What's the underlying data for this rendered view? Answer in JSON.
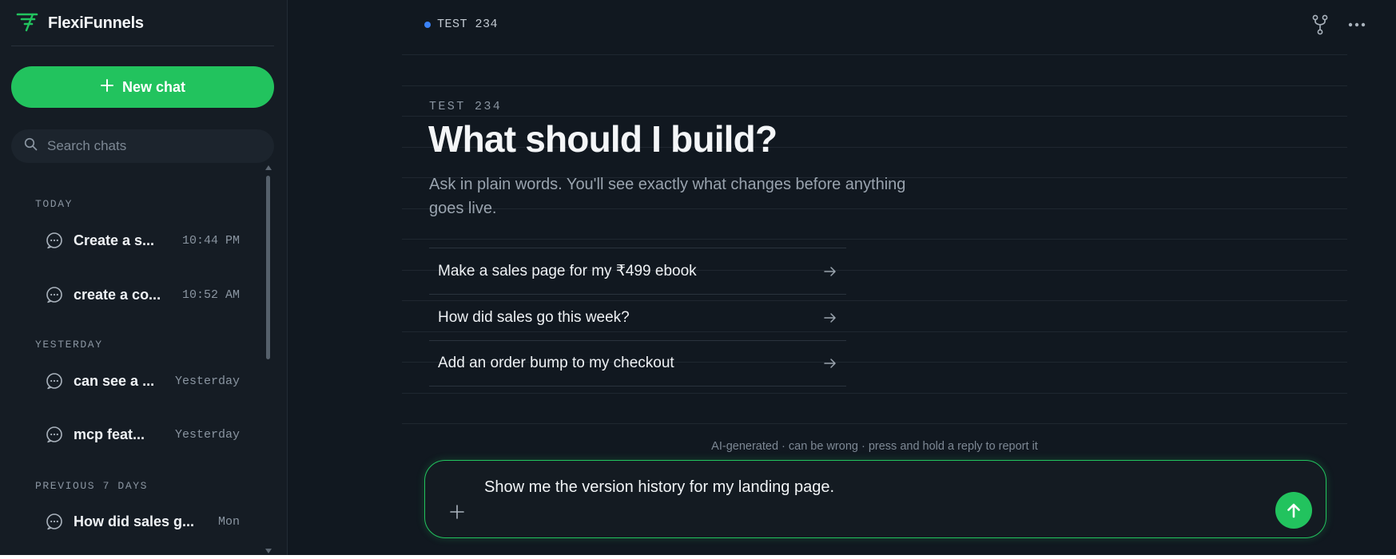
{
  "colors": {
    "accent": "#22c35e",
    "background": "#111820",
    "sidebar": "#151c24",
    "status_dot": "#3b82f6"
  },
  "sidebar": {
    "brand": {
      "name": "FlexiFunnels",
      "icon": "flexifunnels-logo-icon"
    },
    "new_chat_label": "New chat",
    "search": {
      "placeholder": "Search chats",
      "value": ""
    },
    "groups": [
      {
        "label": "TODAY",
        "items": [
          {
            "title": "Create a s...",
            "time": "10:44 PM"
          },
          {
            "title": "create a co...",
            "time": "10:52 AM"
          }
        ]
      },
      {
        "label": "YESTERDAY",
        "items": [
          {
            "title": "can see a ...",
            "time": "Yesterday"
          },
          {
            "title": "mcp feat...",
            "time": "Yesterday"
          }
        ]
      },
      {
        "label": "PREVIOUS 7 DAYS",
        "items": [
          {
            "title": "How did sales g...",
            "time": "Mon"
          }
        ]
      }
    ]
  },
  "header": {
    "project_label": "TEST 234",
    "actions": [
      "version-branch-icon",
      "more-options-icon"
    ]
  },
  "hero": {
    "eyebrow": "TEST 234",
    "title": "What should I build?",
    "subtitle": "Ask in plain words. You'll see exactly what changes before anything goes live."
  },
  "suggestions": [
    "Make a sales page for my ₹499 ebook",
    "How did sales go this week?",
    "Add an order bump to my checkout"
  ],
  "disclaimer": "AI-generated · can be wrong · press and hold a reply to report it",
  "composer": {
    "value": "Show me the version history for my landing page.",
    "placeholder": ""
  }
}
